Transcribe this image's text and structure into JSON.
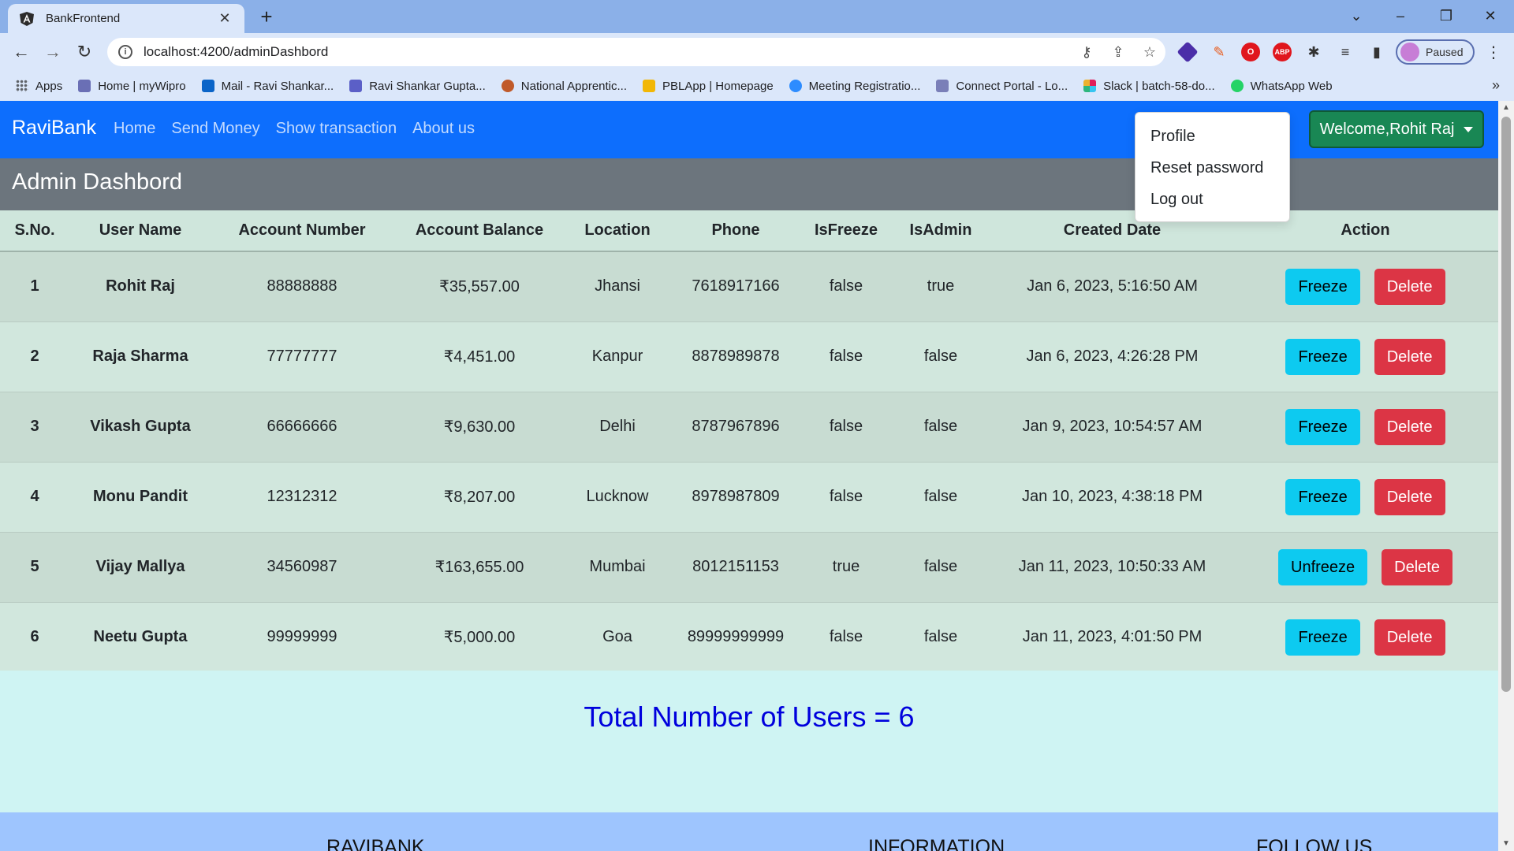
{
  "browser": {
    "tab_title": "BankFrontend",
    "url": "localhost:4200/adminDashbord",
    "profile_status": "Paused",
    "bookmarks": [
      {
        "label": "Apps",
        "icon": "apps-grid-icon",
        "color": "#5f6368"
      },
      {
        "label": "Home | myWipro",
        "icon": "mywipro-icon",
        "color": "#6a6fb5"
      },
      {
        "label": "Mail - Ravi Shankar...",
        "icon": "outlook-icon",
        "color": "#0a64c8"
      },
      {
        "label": "Ravi Shankar Gupta...",
        "icon": "teams-icon",
        "color": "#5b5fc7"
      },
      {
        "label": "National Apprentic...",
        "icon": "apprenticeship-icon",
        "color": "#c05a2a"
      },
      {
        "label": "PBLApp | Homepage",
        "icon": "pblapp-icon",
        "color": "#f2b705"
      },
      {
        "label": "Meeting Registratio...",
        "icon": "zoom-icon",
        "color": "#2d8cff"
      },
      {
        "label": "Connect Portal - Lo...",
        "icon": "connect-portal-icon",
        "color": "#7a7fb8"
      },
      {
        "label": "Slack | batch-58-do...",
        "icon": "slack-icon",
        "color": "#e01e5a"
      },
      {
        "label": "WhatsApp Web",
        "icon": "whatsapp-icon",
        "color": "#25d366"
      }
    ]
  },
  "app": {
    "brand": "RaviBank",
    "nav_links": [
      "Home",
      "Send Money",
      "Show transaction",
      "About us"
    ],
    "welcome_label": "Welcome,Rohit Raj",
    "dropdown_items": [
      "Profile",
      "Reset password",
      "Log out"
    ],
    "page_title": "Admin Dashbord",
    "columns": [
      "S.No.",
      "User Name",
      "Account Number",
      "Account Balance",
      "Location",
      "Phone",
      "IsFreeze",
      "IsAdmin",
      "Created Date",
      "Action"
    ],
    "users": [
      {
        "sno": "1",
        "name": "Rohit Raj",
        "account": "88888888",
        "balance": "₹35,557.00",
        "location": "Jhansi",
        "phone": "7618917166",
        "is_freeze": "false",
        "is_admin": "true",
        "created": "Jan 6, 2023, 5:16:50 AM",
        "freeze_label": "Freeze",
        "delete_label": "Delete"
      },
      {
        "sno": "2",
        "name": "Raja Sharma",
        "account": "77777777",
        "balance": "₹4,451.00",
        "location": "Kanpur",
        "phone": "8878989878",
        "is_freeze": "false",
        "is_admin": "false",
        "created": "Jan 6, 2023, 4:26:28 PM",
        "freeze_label": "Freeze",
        "delete_label": "Delete"
      },
      {
        "sno": "3",
        "name": "Vikash Gupta",
        "account": "66666666",
        "balance": "₹9,630.00",
        "location": "Delhi",
        "phone": "8787967896",
        "is_freeze": "false",
        "is_admin": "false",
        "created": "Jan 9, 2023, 10:54:57 AM",
        "freeze_label": "Freeze",
        "delete_label": "Delete"
      },
      {
        "sno": "4",
        "name": "Monu Pandit",
        "account": "12312312",
        "balance": "₹8,207.00",
        "location": "Lucknow",
        "phone": "8978987809",
        "is_freeze": "false",
        "is_admin": "false",
        "created": "Jan 10, 2023, 4:38:18 PM",
        "freeze_label": "Freeze",
        "delete_label": "Delete"
      },
      {
        "sno": "5",
        "name": "Vijay Mallya",
        "account": "34560987",
        "balance": "₹163,655.00",
        "location": "Mumbai",
        "phone": "8012151153",
        "is_freeze": "true",
        "is_admin": "false",
        "created": "Jan 11, 2023, 10:50:33 AM",
        "freeze_label": "Unfreeze",
        "delete_label": "Delete"
      },
      {
        "sno": "6",
        "name": "Neetu Gupta",
        "account": "99999999",
        "balance": "₹5,000.00",
        "location": "Goa",
        "phone": "89999999999",
        "is_freeze": "false",
        "is_admin": "false",
        "created": "Jan 11, 2023, 4:01:50 PM",
        "freeze_label": "Freeze",
        "delete_label": "Delete"
      }
    ],
    "total_label": "Total Number of Users = 6",
    "footer_headings": [
      "RAVIBANK",
      "INFORMATION",
      "FOLLOW US"
    ]
  },
  "colors": {
    "navbar": "#0d6efd",
    "header": "#6c757d",
    "welcome": "#198754",
    "freeze": "#0dcaf0",
    "delete": "#dc3545",
    "total_text": "#0000dd"
  }
}
